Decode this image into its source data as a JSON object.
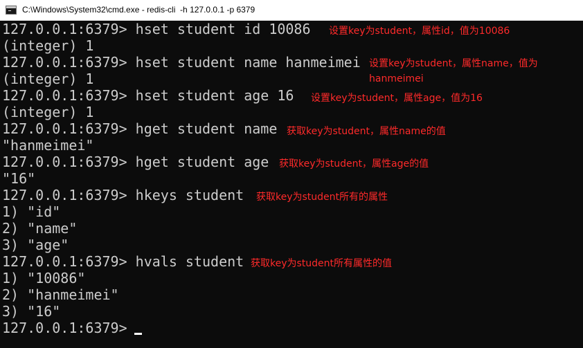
{
  "window": {
    "title": "C:\\Windows\\System32\\cmd.exe - redis-cli  -h 127.0.0.1 -p 6379"
  },
  "console": {
    "lines": [
      "127.0.0.1:6379> hset student id 10086",
      "(integer) 1",
      "127.0.0.1:6379> hset student name hanmeimei",
      "(integer) 1",
      "127.0.0.1:6379> hset student age 16",
      "(integer) 1",
      "127.0.0.1:6379> hget student name",
      "\"hanmeimei\"",
      "127.0.0.1:6379> hget student age",
      "\"16\"",
      "127.0.0.1:6379> hkeys student",
      "1) \"id\"",
      "2) \"name\"",
      "3) \"age\"",
      "127.0.0.1:6379> hvals student",
      "1) \"10086\"",
      "2) \"hanmeimei\"",
      "3) \"16\"",
      "127.0.0.1:6379> "
    ],
    "annotations": [
      "设置key为student，属性id，值为10086",
      "设置key为student，属性name，值为",
      "hanmeimei",
      "设置key为student，属性age，值为16",
      "获取key为student，属性name的值",
      "获取key为student，属性age的值",
      "获取key为student所有的属性",
      "获取key为student所有属性的值"
    ]
  },
  "colors": {
    "console_bg": "#0c0c0c",
    "console_text": "#cccccc",
    "annotation": "#ff2a2a",
    "cursor": "#ffffff",
    "titlebar_bg": "#ffffff"
  },
  "icons": {
    "app": "cmd-console-icon"
  }
}
